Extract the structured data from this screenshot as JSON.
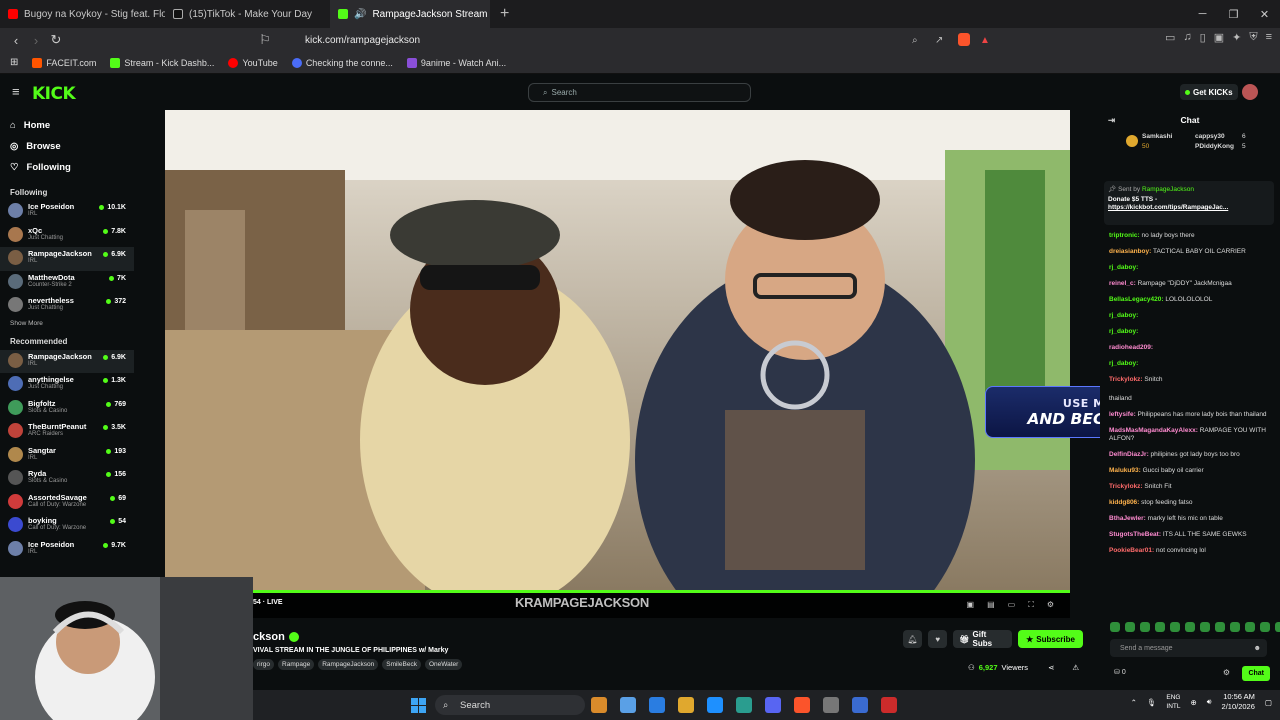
{
  "browser": {
    "tabs": [
      {
        "label": "Bugoy na Koykoy - Stig feat. Flow G",
        "color": "#ff0000"
      },
      {
        "label": "(15)TikTok - Make Your Day",
        "color": "#222222"
      },
      {
        "label": "RampageJackson Stream - W",
        "color": "#53fc18"
      }
    ],
    "url": "kick.com/rampagejackson",
    "bookmarks": [
      {
        "label": "FACEIT.com",
        "color": "#ff5500"
      },
      {
        "label": "Stream - Kick Dashb...",
        "color": "#53fc18"
      },
      {
        "label": "YouTube",
        "color": "#ff0000"
      },
      {
        "label": "Checking the conne...",
        "color": "#4a6cf7"
      },
      {
        "label": "9anime - Watch Ani...",
        "color": "#8a4fd8"
      }
    ]
  },
  "kick": {
    "logo": "KICK",
    "search_placeholder": "Search",
    "get_kicks": "Get KICKs",
    "nav": [
      {
        "label": "Home",
        "icon": "home-icon"
      },
      {
        "label": "Browse",
        "icon": "compass-icon"
      },
      {
        "label": "Following",
        "icon": "heart-icon"
      }
    ],
    "following_header": "Following",
    "following": [
      {
        "name": "Ice Poseidon",
        "cat": "IRL",
        "viewers": "10.1K",
        "color": "#6d7fa8"
      },
      {
        "name": "xQc",
        "cat": "Just Chatting",
        "viewers": "7.8K",
        "color": "#a8774e"
      },
      {
        "name": "RampageJackson",
        "cat": "IRL",
        "viewers": "6.9K",
        "color": "#7a5e44"
      },
      {
        "name": "MatthewDota",
        "cat": "Counter-Strike 2",
        "viewers": "7K",
        "color": "#5a6b7a"
      },
      {
        "name": "nevertheless",
        "cat": "Just Chatting",
        "viewers": "372",
        "color": "#777777"
      }
    ],
    "show_more": "Show More",
    "recommended_header": "Recommended",
    "recommended": [
      {
        "name": "RampageJackson",
        "cat": "IRL",
        "viewers": "6.9K",
        "color": "#7a5e44"
      },
      {
        "name": "anythingelse",
        "cat": "Just Chatting",
        "viewers": "1.3K",
        "color": "#4e6db5"
      },
      {
        "name": "Bigfoltz",
        "cat": "Slots & Casino",
        "viewers": "769",
        "color": "#3f9b5a"
      },
      {
        "name": "TheBurntPeanut",
        "cat": "ARC Raiders",
        "viewers": "3.5K",
        "color": "#c0433a"
      },
      {
        "name": "Sangtar",
        "cat": "IRL",
        "viewers": "193",
        "color": "#b0884c"
      },
      {
        "name": "Ryda",
        "cat": "Slots & Casino",
        "viewers": "156",
        "color": "#555555"
      },
      {
        "name": "AssortedSavage",
        "cat": "Call of Duty: Warzone",
        "viewers": "69",
        "color": "#d03b3b"
      },
      {
        "name": "boyking",
        "cat": "Call of Duty: Warzone",
        "viewers": "54",
        "color": "#3b4ad0"
      },
      {
        "name": "Ice Poseidon",
        "cat": "IRL",
        "viewers": "9.7K",
        "color": "#6d7fa8"
      }
    ],
    "player": {
      "live": "54 · LIVE",
      "watermark": "KRAMPAGEJACKSON"
    },
    "stream": {
      "channel": "ckson",
      "title": "VIVAL STREAM IN THE JUNGLE OF PHILIPPINES w/ Marky",
      "tags": [
        "rirgo",
        "Rampage",
        "RampageJackson",
        "SmileBeck",
        "OneWater"
      ],
      "gift": "Gift Subs",
      "subscribe": "Subscribe",
      "viewers": "6,927",
      "viewers_label": "Viewers"
    },
    "chat": {
      "title": "Chat",
      "gifters": [
        {
          "name": "Samkashi",
          "count": "50"
        },
        {
          "name": "cappsy30",
          "count": "6"
        },
        {
          "name": "PDiddyKong",
          "count": "5"
        }
      ],
      "pinned_by": "Sent by",
      "pinned_user": "RampageJackson",
      "pinned_text": "Donate $5 TTS -",
      "pinned_link": "https://kickbot.com/tips/RampageJac...",
      "messages": [
        {
          "user": "triptronic:",
          "text": "no lady boys there",
          "color": "#53fc18"
        },
        {
          "user": "dreiasianboy:",
          "text": "TACTICAL BABY OIL CARRIER",
          "color": "#ffb34d"
        },
        {
          "user": "rj_daboy:",
          "text": "",
          "color": "#53fc18"
        },
        {
          "user": "reinel_c:",
          "text": "Rampage \"DjDDY\" JackMcnigaa",
          "color": "#ff8bd0"
        },
        {
          "user": "BellasLegacy420:",
          "text": "LOLOLOLOLOL",
          "color": "#53fc18"
        },
        {
          "user": "rj_daboy:",
          "text": "",
          "color": "#53fc18"
        },
        {
          "user": "rj_daboy:",
          "text": "",
          "color": "#53fc18"
        },
        {
          "user": "radiohead209:",
          "text": "",
          "color": "#ff8bd0"
        },
        {
          "user": "rj_daboy:",
          "text": "",
          "color": "#53fc18"
        },
        {
          "user": "Trickylokz:",
          "text": "Snitch",
          "color": "#ff6b6b"
        },
        {
          "user": "",
          "text": "thailand",
          "color": "#dddddd"
        },
        {
          "user": "leftysife:",
          "text": "Philippeans has more lady bois than thailand",
          "color": "#ff8bd0"
        },
        {
          "user": "MadsMasMagandaKayAlexx:",
          "text": "RAMPAGE YOU WITH ALFON?",
          "color": "#ff8bd0"
        },
        {
          "user": "DelfinDiazJr:",
          "text": "philipines got lady boys too bro",
          "color": "#ff8bd0"
        },
        {
          "user": "Maluku93:",
          "text": "Gucci baby oil carrier",
          "color": "#ffb34d"
        },
        {
          "user": "Trickylokz:",
          "text": "Snitch Fit",
          "color": "#ff6b6b"
        },
        {
          "user": "kiddg806:",
          "text": "stop feeding fatso",
          "color": "#ffb34d"
        },
        {
          "user": "BthaJewler:",
          "text": "marky left his mic on table",
          "color": "#ff8bd0"
        },
        {
          "user": "StugotsTheBeat:",
          "text": "ITS ALL THE SAME GEWKS",
          "color": "#ff8bd0"
        },
        {
          "user": "PookieBear01:",
          "text": "not convincing lol",
          "color": "#ff6b6b"
        }
      ],
      "promo_line1": "USE MY PROMOCODE",
      "promo_line2": "AND BECOME A WINNER",
      "input_placeholder": "Send a message",
      "kicks_count": "0",
      "send": "Chat"
    }
  },
  "taskbar": {
    "search": "Search",
    "lang1": "ENG",
    "lang2": "INTL",
    "time": "10:56 AM",
    "date": "2/10/2026",
    "icons": [
      "#d98b2b",
      "#5aa0e6",
      "#2a7de1",
      "#e0a82e",
      "#1e90ff",
      "#2a9d8f",
      "#5865f2",
      "#fb542b",
      "#777777",
      "#3a6bd1",
      "#cc2b2b"
    ]
  },
  "colors": {
    "accent": "#53fc18",
    "bg": "#0b0e0f"
  }
}
